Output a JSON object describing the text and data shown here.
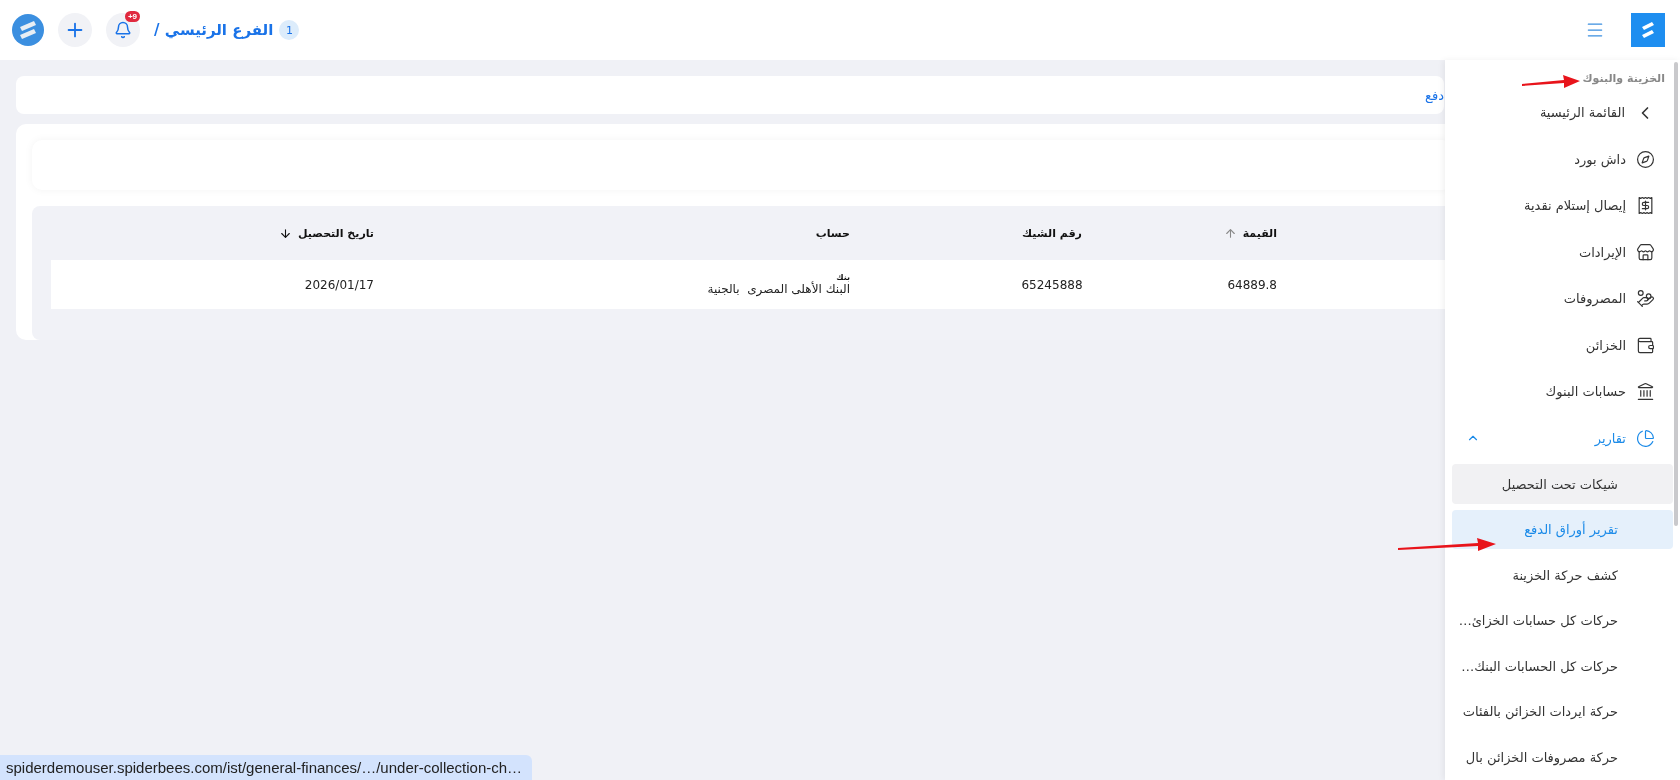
{
  "header": {
    "branch_number": "1",
    "branch": "الفرع الرئيسي /",
    "notifications_badge": "+9"
  },
  "breadcrumb": {
    "title": "دفع"
  },
  "table": {
    "columns": [
      {
        "label": "القيمة",
        "sorted": true,
        "ascending": true
      },
      {
        "label": "رقم الشيك",
        "sorted": false
      },
      {
        "label": "حساب",
        "sorted": false
      },
      {
        "label": "تاريخ التحصيل",
        "sorted": true,
        "ascending": false
      }
    ],
    "rows": [
      {
        "value": "64889.8",
        "check_number": "65245888",
        "account_type": "بنك",
        "account": "البنك الأهلى المصرى  بالجنية",
        "collection_date": "2026/01/17"
      }
    ]
  },
  "sidebar": {
    "section": "الخزينة والبنوك",
    "items": [
      {
        "kind": "back",
        "label": "القائمة الرئيسية",
        "selected": false
      },
      {
        "kind": "link",
        "label": "داش بورد",
        "selected": false
      },
      {
        "kind": "link",
        "label": "إيصال إستلام نقدية",
        "selected": false
      },
      {
        "kind": "link",
        "label": "الإيرادات",
        "selected": false
      },
      {
        "kind": "link",
        "label": "المصروفات",
        "selected": false
      },
      {
        "kind": "link",
        "label": "الخزائن",
        "selected": false
      },
      {
        "kind": "link",
        "label": "حسابات البنوك",
        "selected": false
      },
      {
        "kind": "group",
        "label": "تقارير",
        "selected": true,
        "expanded": true,
        "children": [
          {
            "label": "شيكات تحت التحصيل",
            "selected": false,
            "hovered": true
          },
          {
            "label": "تقرير أوراق الدفع",
            "selected": true,
            "hovered": false
          },
          {
            "label": "كشف حركة الخزينة",
            "selected": false,
            "hovered": false
          },
          {
            "label": "حركات كل حسابات الخزائ…",
            "selected": false,
            "hovered": false
          },
          {
            "label": "حركات كل الحسابات البنك…",
            "selected": false,
            "hovered": false
          },
          {
            "label": "حركة ايردات الخزائن بالفئات",
            "selected": false,
            "hovered": false
          },
          {
            "label": "حركة مصروفات الخزائن بال",
            "selected": false,
            "hovered": false
          }
        ]
      }
    ]
  },
  "status_bar": {
    "url": "spiderdemouser.spiderbees.com/ist/general-finances/…/under-collection-ch…"
  }
}
